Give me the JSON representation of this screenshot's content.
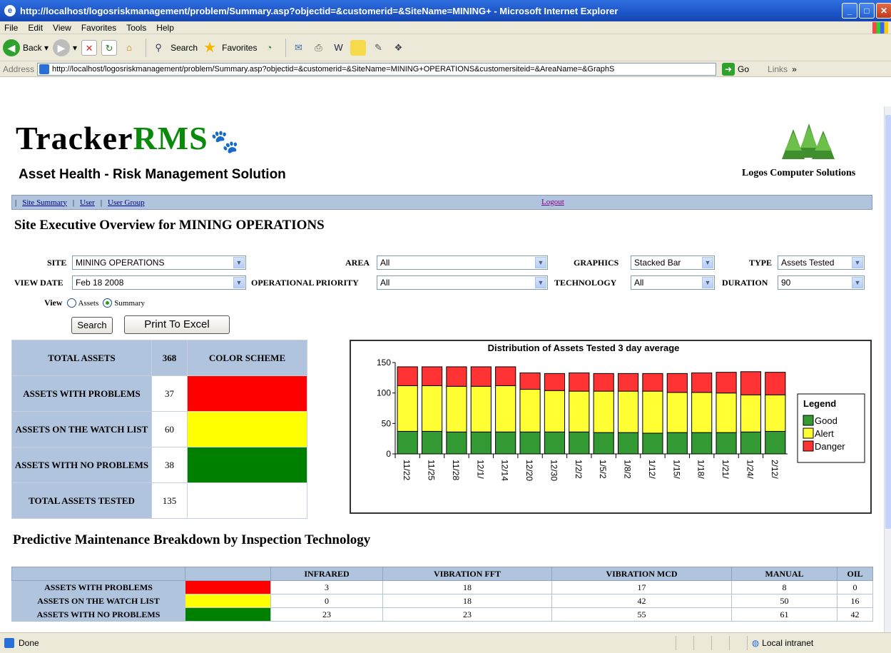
{
  "window": {
    "title": "http://localhost/logosriskmanagement/problem/Summary.asp?objectid=&customerid=&SiteName=MINING+ - Microsoft Internet Explorer"
  },
  "menu": [
    "File",
    "Edit",
    "View",
    "Favorites",
    "Tools",
    "Help"
  ],
  "toolbar": {
    "back": "Back",
    "search": "Search",
    "favorites": "Favorites"
  },
  "addressbar": {
    "label": "Address",
    "url": "http://localhost/logosriskmanagement/problem/Summary.asp?objectid=&customerid=&SiteName=MINING+OPERATIONS&customersiteid=&AreaName=&GraphS",
    "go": "Go",
    "links": "Links"
  },
  "header": {
    "logo_tracker": "Tracker",
    "logo_rms": "RMS",
    "tagline": "Asset Health - Risk Management Solution",
    "company": "Logos Computer Solutions"
  },
  "nav": {
    "site_summary": "Site Summary",
    "user": "User",
    "user_group": "User Group",
    "logout": "Logout"
  },
  "page_title": "Site Executive Overview for MINING OPERATIONS",
  "filters": {
    "site_label": "SITE",
    "site_value": "MINING OPERATIONS",
    "area_label": "AREA",
    "area_value": "All",
    "graphics_label": "GRAPHICS",
    "graphics_value": "Stacked Bar",
    "type_label": "TYPE",
    "type_value": "Assets Tested",
    "view_date_label": "VIEW DATE",
    "view_date_value": "Feb 18 2008",
    "op_priority_label": "OPERATIONAL PRIORITY",
    "op_priority_value": "All",
    "technology_label": "TECHNOLOGY",
    "technology_value": "All",
    "duration_label": "DURATION",
    "duration_value": "90",
    "view_label": "View",
    "view_assets": "Assets",
    "view_summary": "Summary",
    "search_button": "Search",
    "excel_button": "Print To Excel"
  },
  "summary": {
    "total_assets_label": "TOTAL ASSETS",
    "total_assets_value": "368",
    "color_scheme_label": "COLOR SCHEME",
    "problems_label": "ASSETS WITH PROBLEMS",
    "problems_value": "37",
    "watch_label": "ASSETS ON THE WATCH LIST",
    "watch_value": "60",
    "noproblem_label": "ASSETS WITH NO PROBLEMS",
    "noproblem_value": "38",
    "tested_label": "TOTAL ASSETS TESTED",
    "tested_value": "135"
  },
  "colors": {
    "danger": "#ff0000",
    "alert": "#ffff00",
    "good": "#008000",
    "chart_good": "#339933",
    "chart_alert": "#ffff33",
    "chart_danger": "#ff3333",
    "header_blue": "#b0c4de"
  },
  "chart_data": {
    "type": "bar",
    "stacked": true,
    "title": "Distribution of Assets Tested 3 day average",
    "categories": [
      "11/22",
      "11/25",
      "11/28",
      "12/1/",
      "12/14",
      "12/20",
      "12/30",
      "1/2/2",
      "1/5/2",
      "1/8/2",
      "1/12/",
      "1/15/",
      "1/18/",
      "1/21/",
      "1/24/",
      "2/12/"
    ],
    "series": [
      {
        "name": "Good",
        "values": [
          37,
          37,
          36,
          36,
          36,
          36,
          36,
          36,
          35,
          35,
          34,
          35,
          35,
          35,
          36,
          37
        ]
      },
      {
        "name": "Alert",
        "values": [
          75,
          75,
          75,
          75,
          76,
          70,
          68,
          67,
          68,
          68,
          69,
          66,
          66,
          65,
          61,
          60
        ]
      },
      {
        "name": "Danger",
        "values": [
          31,
          31,
          32,
          32,
          31,
          27,
          28,
          30,
          29,
          29,
          29,
          31,
          32,
          34,
          38,
          37
        ]
      }
    ],
    "ylim": [
      0,
      150
    ],
    "yticks": [
      0,
      50,
      100,
      150
    ],
    "legend_title": "Legend",
    "legend_position": "right"
  },
  "pmb": {
    "title": "Predictive Maintenance Breakdown by Inspection Technology",
    "columns": [
      "INFRARED",
      "VIBRATION FFT",
      "VIBRATION MCD",
      "MANUAL",
      "OIL"
    ],
    "rows": [
      {
        "label": "ASSETS WITH PROBLEMS",
        "color": "#ff0000",
        "values": [
          "3",
          "18",
          "17",
          "8",
          "0"
        ]
      },
      {
        "label": "ASSETS ON THE WATCH LIST",
        "color": "#ffff00",
        "values": [
          "0",
          "18",
          "42",
          "50",
          "16"
        ]
      },
      {
        "label": "ASSETS WITH NO PROBLEMS",
        "color": "#008000",
        "values": [
          "23",
          "23",
          "55",
          "61",
          "42"
        ]
      }
    ]
  },
  "status": {
    "left": "Done",
    "zone": "Local intranet"
  }
}
